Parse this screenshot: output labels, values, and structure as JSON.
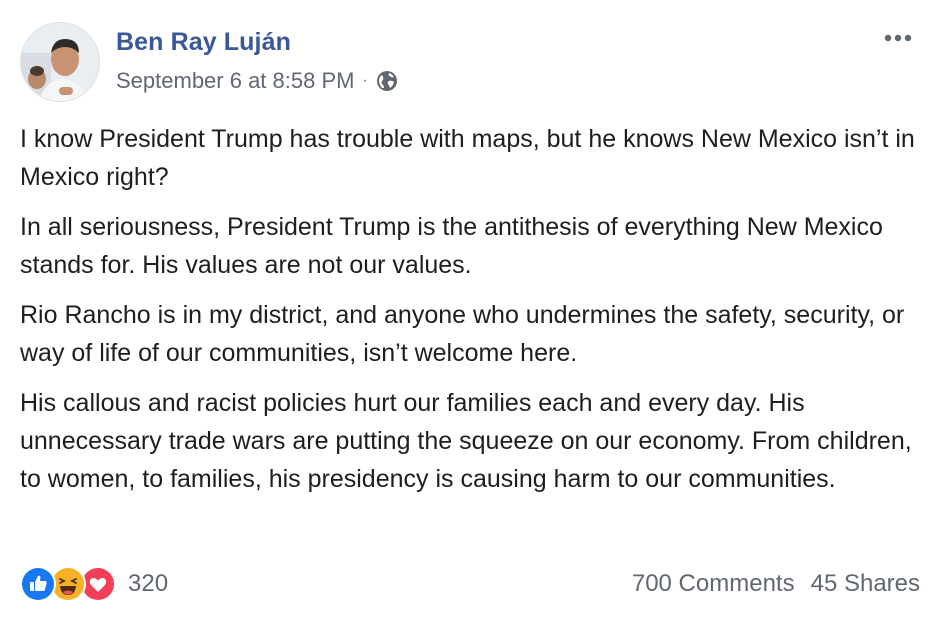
{
  "post": {
    "author": "Ben Ray Luján",
    "timestamp": "September 6 at 8:58 PM",
    "separator": "·",
    "privacy_icon": "globe-icon",
    "more_icon": "more-options-icon",
    "paragraphs": [
      "I know President Trump has trouble with maps, but he knows New Mexico isn’t in Mexico right?",
      "In all seriousness, President Trump is the antithesis of everything New Mexico stands for. His values are not our values.",
      "Rio Rancho is in my district, and anyone who undermines the safety, security, or way of life of our communities, isn’t welcome here.",
      "His callous and racist policies hurt our families each and every day. His unnecessary trade wars are putting the squeeze on our economy. From children, to women, to families, his presidency is causing harm to our communities."
    ]
  },
  "engagement": {
    "reaction_icons": [
      "like-icon",
      "haha-icon",
      "love-icon"
    ],
    "reaction_count": "320",
    "comments": "700 Comments",
    "shares": "45 Shares"
  },
  "colors": {
    "author_link": "#385898",
    "meta_text": "#616770",
    "body_text": "#1c1e21",
    "like_blue": "#1877f2",
    "haha_yellow": "#f7b125",
    "love_red": "#f33e58"
  }
}
